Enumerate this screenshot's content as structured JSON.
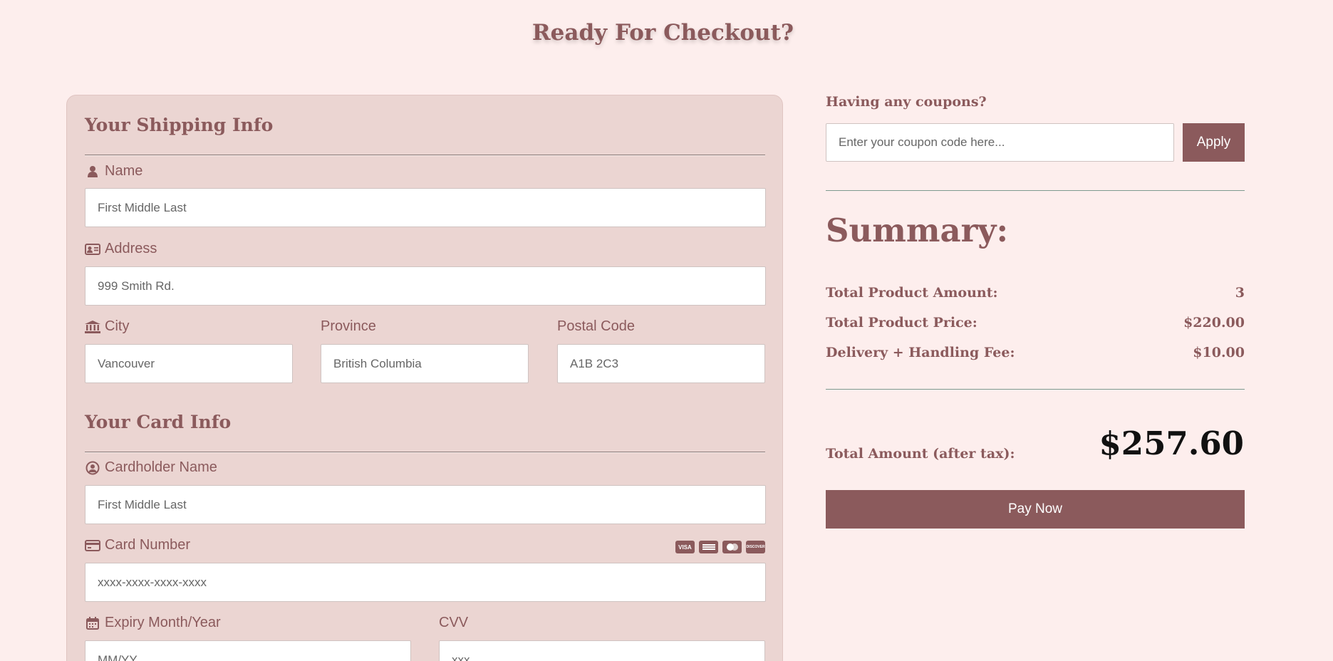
{
  "page": {
    "title": "Ready For Checkout?"
  },
  "shipping": {
    "title": "Your Shipping Info",
    "name_label": "Name",
    "name_placeholder": "First Middle Last",
    "address_label": "Address",
    "address_placeholder": "999 Smith Rd.",
    "city_label": "City",
    "city_placeholder": "Vancouver",
    "province_label": "Province",
    "province_placeholder": "British Columbia",
    "postal_label": "Postal Code",
    "postal_placeholder": "A1B 2C3"
  },
  "card": {
    "title": "Your Card Info",
    "holder_label": "Cardholder Name",
    "holder_placeholder": "First Middle Last",
    "number_label": "Card Number",
    "number_placeholder": "xxxx-xxxx-xxxx-xxxx",
    "brands": [
      "VISA",
      "AMEX",
      "MC",
      "DISC"
    ],
    "expiry_label": "Expiry Month/Year",
    "expiry_placeholder": "MM/YY",
    "cvv_label": "CVV",
    "cvv_placeholder": "xxx"
  },
  "coupon": {
    "label": "Having any coupons?",
    "placeholder": "Enter your coupon code here...",
    "apply_label": "Apply"
  },
  "summary": {
    "title": "Summary:",
    "rows": [
      {
        "label": "Total Product Amount:",
        "value": "3"
      },
      {
        "label": "Total Product Price:",
        "value": "$220.00"
      },
      {
        "label": "Delivery + Handling Fee:",
        "value": "$10.00"
      }
    ],
    "total_label": "Total Amount (after tax):",
    "total_value": "$257.60",
    "pay_label": "Pay Now"
  },
  "colors": {
    "accent": "#8b5a5c",
    "background": "#fdeeed",
    "panel": "#ebd5d2"
  },
  "icons": {
    "name": "user-icon",
    "address": "id-card-icon",
    "city": "bank-icon",
    "holder": "user-circle-icon",
    "number": "credit-card-icon",
    "expiry": "calendar-icon"
  }
}
